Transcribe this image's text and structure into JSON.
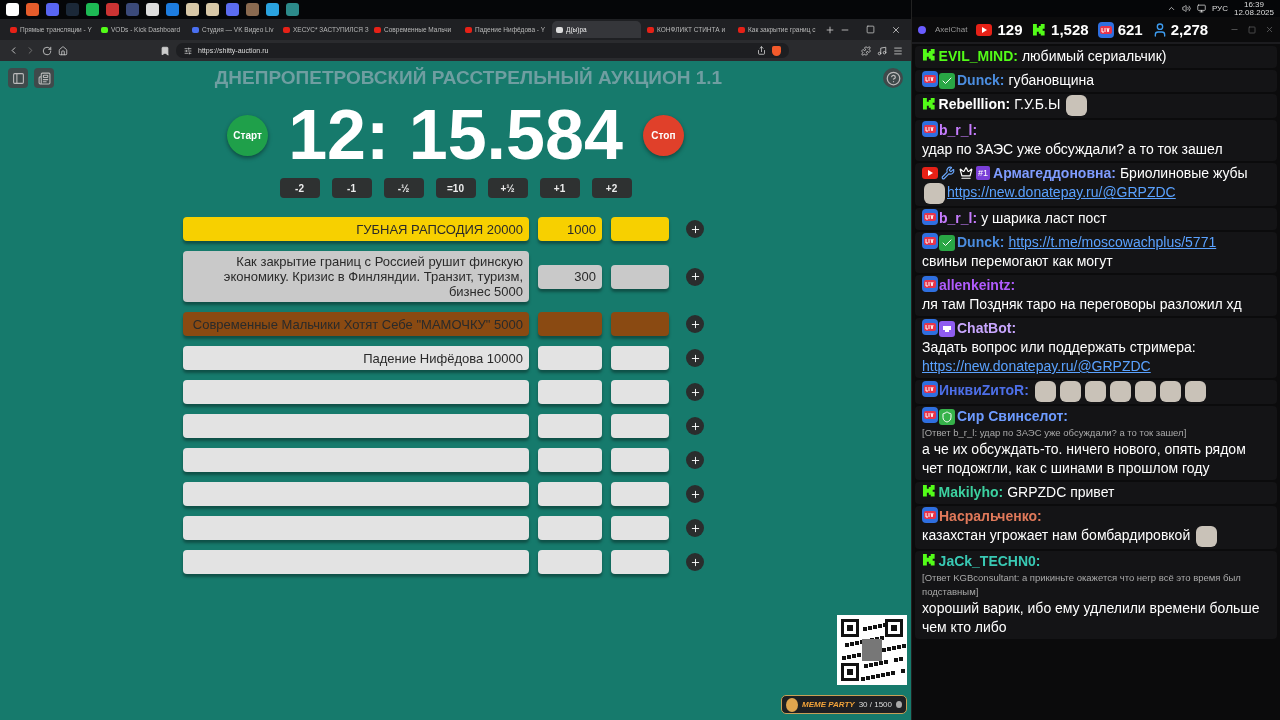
{
  "browser": {
    "tabs": [
      {
        "title": "Прямые трансляции - Y",
        "kind": "youtube",
        "selected": false
      },
      {
        "title": "VODs - Kick Dashboard",
        "kind": "kick",
        "selected": false
      },
      {
        "title": "Студия — VK Видео Liv",
        "kind": "vk",
        "selected": false
      },
      {
        "title": "ХЕСУС* ЗАСТУПИЛСЯ З",
        "kind": "youtube",
        "selected": false
      },
      {
        "title": "Современные Мальчи",
        "kind": "youtube",
        "selected": false
      },
      {
        "title": "Падение Нифёдова - Y",
        "kind": "youtube",
        "selected": false
      },
      {
        "title": "Д(ы)ра",
        "kind": "site",
        "selected": true
      },
      {
        "title": "КОНФЛИКТ СТИНТА и",
        "kind": "youtube",
        "selected": false
      },
      {
        "title": "Как закрытие границ с",
        "kind": "youtube",
        "selected": false
      }
    ],
    "url": "https://shitty-auction.ru"
  },
  "tray": {
    "language": "РУС",
    "time": "16:39",
    "date": "12.08.2025"
  },
  "auction": {
    "title": "ДНЕПРОПЕТРОВСКИЙ РАССТРЕЛЬНЫЙ АУКЦИОН 1.1",
    "start": "Старт",
    "stop": "Стоп",
    "timer": "12: 15.584",
    "adjust": [
      "-2",
      "-1",
      "-½",
      "=10",
      "+½",
      "+1",
      "+2"
    ],
    "lots": [
      {
        "color": "#f7d000",
        "name": "ГУБНАЯ РАПСОДИЯ 20000",
        "amount": "1000"
      },
      {
        "color": "#c9c9c9",
        "name": "Как закрытие границ с Россией рушит финскую экономику. Кризис в Финляндии. Транзит, туризм, бизнес 5000",
        "amount": "300"
      },
      {
        "color": "#8a4a12",
        "name": "Современные Мальчики Хотят Себе \"МАМОЧКУ\" 5000"
      },
      {
        "color": "#e3e3e3",
        "name": "Падение Нифёдова 10000"
      },
      {
        "color": "#e3e3e3"
      },
      {
        "color": "#e3e3e3"
      },
      {
        "color": "#e3e3e3"
      },
      {
        "color": "#e3e3e3"
      },
      {
        "color": "#e3e3e3"
      },
      {
        "color": "#e3e3e3"
      }
    ],
    "widget": {
      "title": "MEME PARTY",
      "count": "30 / 1500"
    }
  },
  "chat": {
    "app": "AxelChat",
    "counts": [
      {
        "kind": "youtube",
        "value": "129"
      },
      {
        "kind": "kick",
        "value": "1,528"
      },
      {
        "kind": "vk",
        "value": "621"
      },
      {
        "kind": "viewers",
        "value": "2,278"
      }
    ],
    "messages": [
      {
        "kind": "kick",
        "author": "EVIL_MIND:",
        "color": "#53fc18",
        "parts": [
          {
            "kind": "text",
            "text": "любимый сериальчик)"
          }
        ]
      },
      {
        "kind": "vk",
        "badges": [
          {
            "kind": "check"
          }
        ],
        "author": "Dunck:",
        "color": "#4b8de0",
        "parts": [
          {
            "kind": "text",
            "text": "губановщина"
          }
        ]
      },
      {
        "kind": "kick",
        "author": "Rebelllion:",
        "color": "#ffffff",
        "parts": [
          {
            "kind": "text",
            "text": "Г.У.Б.Ы"
          },
          {
            "kind": "emote"
          }
        ]
      },
      {
        "kind": "vk",
        "author": "b_r_l:",
        "color": "#c77dff",
        "parts": [
          {
            "kind": "text",
            "text": "удар по ЗАЭС уже обсуждали? а то ток зашел"
          }
        ]
      },
      {
        "kind": "youtube",
        "badges": [
          {
            "kind": "wrench"
          },
          {
            "kind": "crown"
          },
          {
            "kind": "rank",
            "text": "#1"
          }
        ],
        "author": "Армагеддоновна:",
        "color": "#7f9cff",
        "parts": [
          {
            "kind": "text",
            "text": "Бриолиновые жубы"
          },
          {
            "kind": "emote"
          },
          {
            "kind": "link",
            "text": "https://new.donatepay.ru/@GRPZDC"
          }
        ]
      },
      {
        "kind": "vk",
        "author": "b_r_l:",
        "color": "#c77dff",
        "parts": [
          {
            "kind": "text",
            "text": "у шарика ласт пост"
          }
        ]
      },
      {
        "kind": "vk",
        "badges": [
          {
            "kind": "check"
          }
        ],
        "author": "Dunck:",
        "color": "#4b8de0",
        "parts": [
          {
            "kind": "link",
            "text": "https://t.me/moscowachplus/5771"
          },
          {
            "kind": "text",
            "text": "свиньи перемогают как могут"
          }
        ]
      },
      {
        "kind": "vk",
        "author": "allenkeintz:",
        "color": "#b05cff",
        "parts": [
          {
            "kind": "text",
            "text": "ля там Поздняк таро на переговоры разложил хд"
          }
        ]
      },
      {
        "kind": "vk",
        "badges": [
          {
            "kind": "alien"
          }
        ],
        "author": "ChatBot:",
        "color": "#c9a7ff",
        "parts": [
          {
            "kind": "text",
            "text": "Задать вопрос или поддержать стримера:"
          },
          {
            "kind": "link",
            "text": "https://new.donatepay.ru/@GRPZDC"
          }
        ]
      },
      {
        "kind": "vk",
        "author": "ИнквиZитоR:",
        "color": "#4d6fe8",
        "parts": [
          {
            "kind": "emote"
          },
          {
            "kind": "emote"
          },
          {
            "kind": "emote"
          },
          {
            "kind": "emote"
          },
          {
            "kind": "emote"
          },
          {
            "kind": "emote"
          },
          {
            "kind": "emote"
          }
        ]
      },
      {
        "kind": "vk",
        "badges": [
          {
            "kind": "shield"
          }
        ],
        "author": "Сир Свинселот:",
        "color": "#6d9bff",
        "reply": "[Ответ b_r_l: удар по ЗАЭС уже обсуждали? а то ток зашел]",
        "parts": [
          {
            "kind": "text",
            "text": "а че их обсуждать-то. ничего нового, опять рядом чет подожгли, как с шинами в прошлом году"
          }
        ]
      },
      {
        "kind": "kick",
        "author": "Makilyho:",
        "color": "#3cd1a0",
        "parts": [
          {
            "kind": "text",
            "text": "GRPZDC привет"
          }
        ]
      },
      {
        "kind": "vk",
        "author": "Насральченко:",
        "color": "#e0795a",
        "parts": [
          {
            "kind": "text",
            "text": "казахстан угрожает нам бомбардировкой"
          },
          {
            "kind": "emote"
          }
        ]
      },
      {
        "kind": "kick",
        "author": "JaCk_TECHN0:",
        "color": "#39c9b4",
        "reply": "[Ответ KGBconsultant: а прикиньте окажется что негр всё это время был подставным]",
        "parts": [
          {
            "kind": "text",
            "text": "хороший варик, ибо ему удлелили времени больше чем кто либо"
          }
        ]
      }
    ]
  }
}
